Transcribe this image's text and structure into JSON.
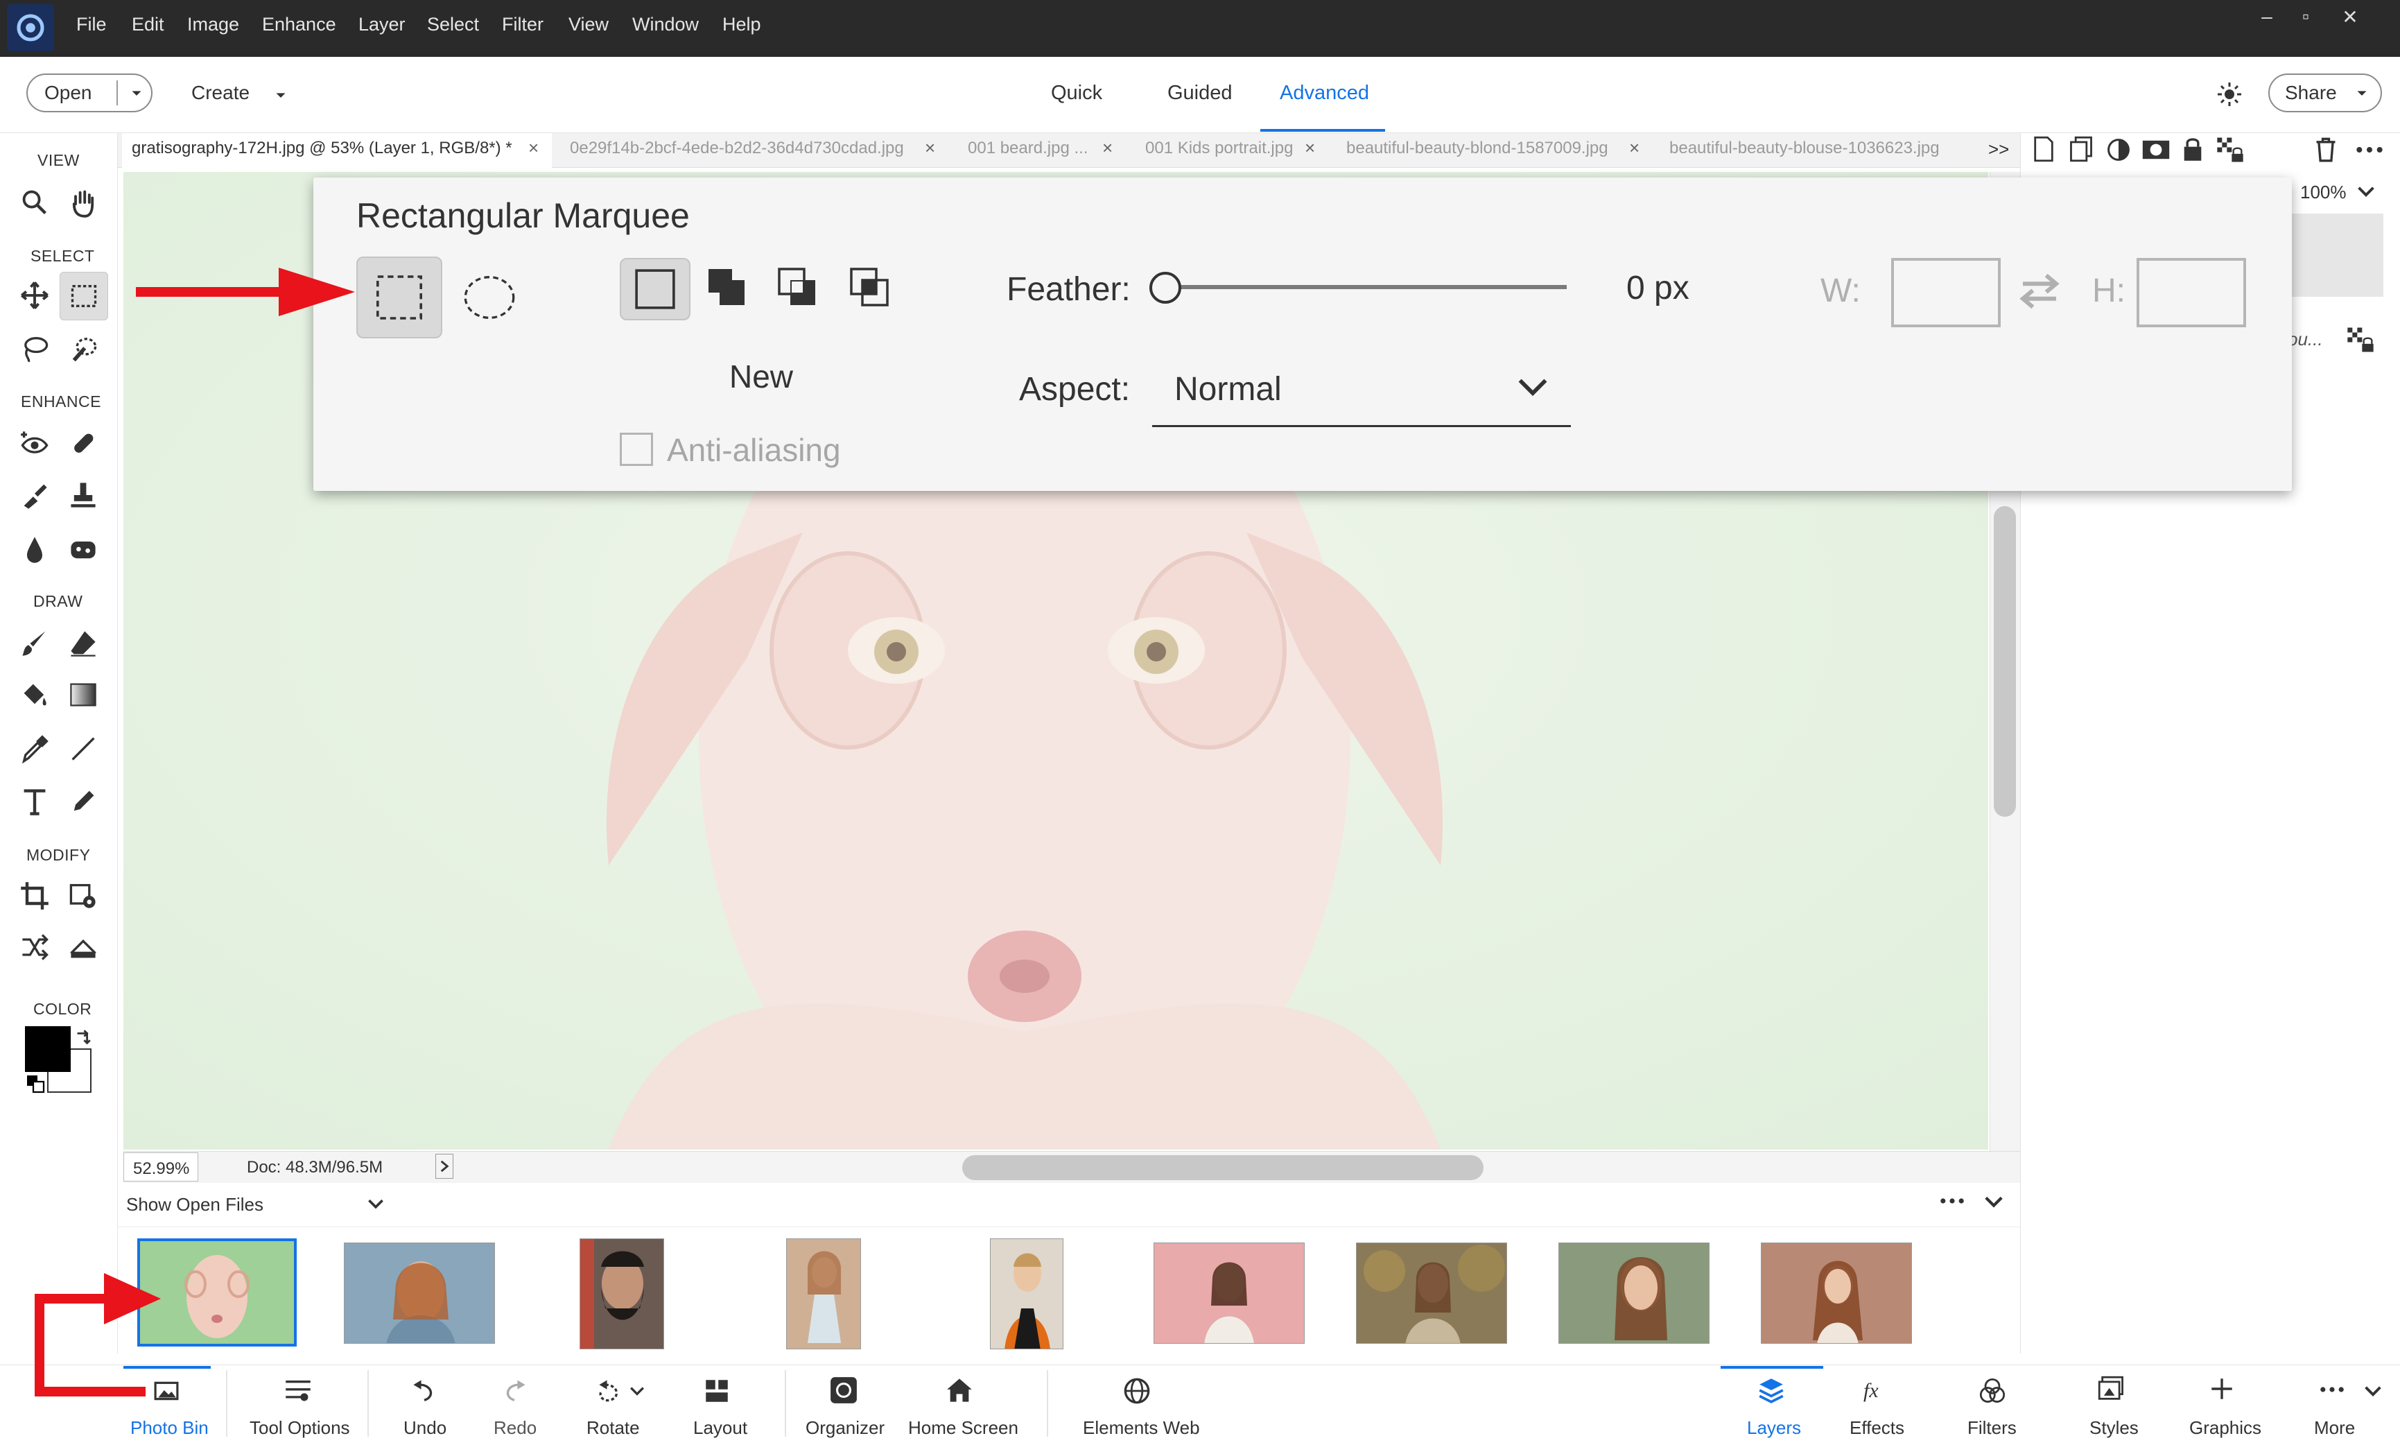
{
  "menu": [
    "File",
    "Edit",
    "Image",
    "Enhance",
    "Layer",
    "Select",
    "Filter",
    "View",
    "Window",
    "Help"
  ],
  "window_controls": {
    "minimize": "–",
    "maximize": "▫",
    "close": "✕"
  },
  "topbar": {
    "open_label": "Open",
    "create_label": "Create",
    "modes": [
      "Quick",
      "Guided",
      "Advanced"
    ],
    "active_mode": "Advanced",
    "share_label": "Share"
  },
  "toolbox": {
    "sections": [
      "VIEW",
      "SELECT",
      "ENHANCE",
      "DRAW",
      "MODIFY",
      "COLOR"
    ]
  },
  "tabs": [
    {
      "label": "gratisography-172H.jpg @ 53% (Layer 1, RGB/8*) *",
      "active": true
    },
    {
      "label": "0e29f14b-2bcf-4ede-b2d2-36d4d730cdad.jpg",
      "active": false
    },
    {
      "label": "001 beard.jpg ...",
      "active": false
    },
    {
      "label": "001 Kids portrait.jpg",
      "active": false
    },
    {
      "label": "beautiful-beauty-blond-1587009.jpg",
      "active": false
    },
    {
      "label": "beautiful-beauty-blouse-1036623.jpg",
      "active": false
    }
  ],
  "tab_close": "×",
  "tab_overflow": ">>",
  "right_panel": {
    "zoom": "100%",
    "layer_name_fragment": "ou..."
  },
  "status": {
    "zoom": "52.99%",
    "doc": "Doc: 48.3M/96.5M"
  },
  "bin": {
    "dropdown_label": "Show Open Files",
    "thumb_colors": [
      "#9ed097",
      "#8aa6ba",
      "#6b5a52",
      "#cfb095",
      "#c9a07f",
      "#e8aaaa",
      "#8a7a58",
      "#8a9a7c",
      "#b88a76"
    ]
  },
  "bottombar": {
    "left": [
      "Photo Bin",
      "Tool Options",
      "Undo",
      "Redo",
      "Rotate",
      "Layout",
      "Organizer",
      "Home Screen",
      "Elements Web"
    ],
    "right": [
      "Layers",
      "Effects",
      "Filters",
      "Styles",
      "Graphics",
      "More"
    ]
  },
  "tool_options": {
    "title": "Rectangular Marquee",
    "mode_label": "New",
    "feather_label": "Feather:",
    "feather_value": "0 px",
    "feather_fraction": 0,
    "aspect_label": "Aspect:",
    "aspect_value": "Normal",
    "antialias_label": "Anti-aliasing",
    "antialias_checked": false,
    "w_label": "W:",
    "h_label": "H:"
  },
  "colors": {
    "accent": "#1473e6",
    "arrow": "#e8131b",
    "titlebar": "#2a2a2a",
    "foreground_color": "#000000",
    "background_color": "#ffffff"
  }
}
